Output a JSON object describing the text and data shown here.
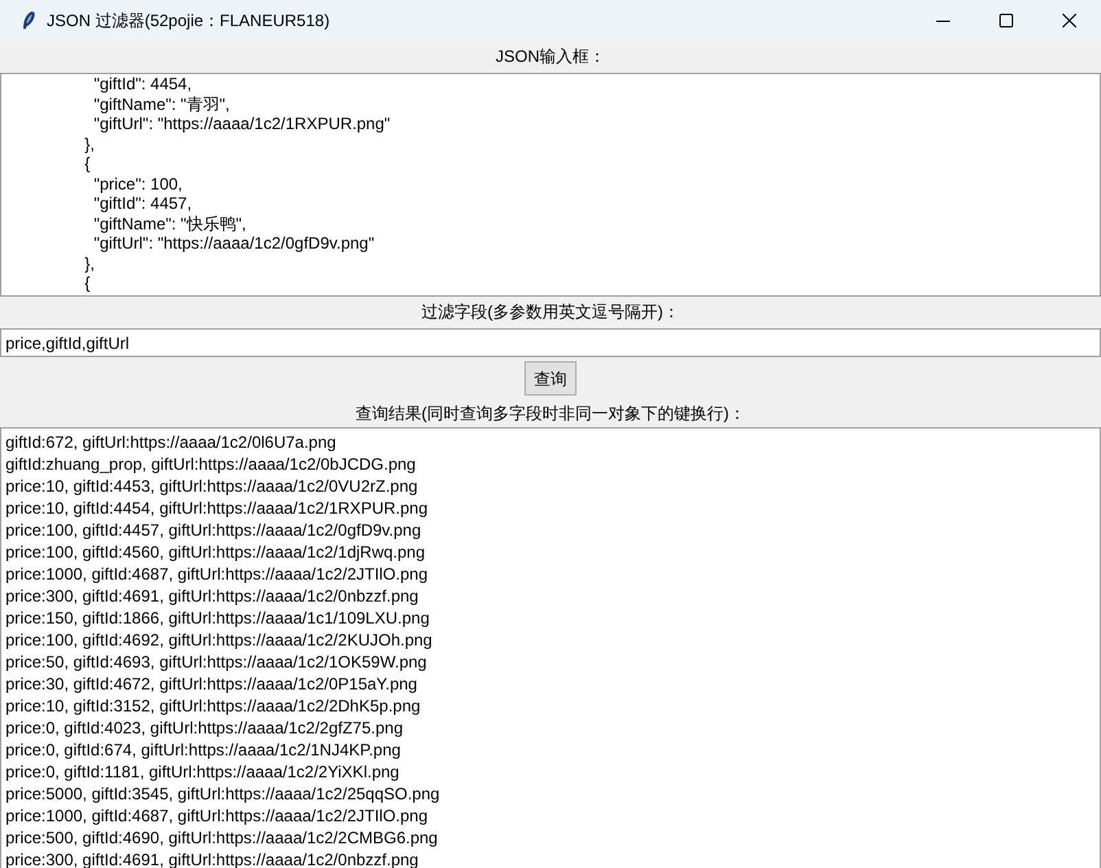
{
  "window": {
    "title": "JSON 过滤器(52pojie：FLANEUR518)"
  },
  "json_input": {
    "label": "JSON输入框：",
    "lines": [
      "    \"giftId\": 4454,",
      "    \"giftName\": \"青羽\",",
      "    \"giftUrl\": \"https://aaaa/1c2/1RXPUR.png\"",
      "  },",
      "  {",
      "    \"price\": 100,",
      "    \"giftId\": 4457,",
      "    \"giftName\": \"快乐鸭\",",
      "    \"giftUrl\": \"https://aaaa/1c2/0gfD9v.png\"",
      "  },",
      "  {"
    ]
  },
  "filter": {
    "label": "过滤字段(多参数用英文逗号隔开)：",
    "value": "price,giftId,giftUrl"
  },
  "query_button": "查询",
  "results": {
    "label": "查询结果(同时查询多字段时非同一对象下的键换行)：",
    "lines": [
      "giftId:672, giftUrl:https://aaaa/1c2/0l6U7a.png",
      "giftId:zhuang_prop, giftUrl:https://aaaa/1c2/0bJCDG.png",
      "price:10, giftId:4453, giftUrl:https://aaaa/1c2/0VU2rZ.png",
      "price:10, giftId:4454, giftUrl:https://aaaa/1c2/1RXPUR.png",
      "price:100, giftId:4457, giftUrl:https://aaaa/1c2/0gfD9v.png",
      "price:100, giftId:4560, giftUrl:https://aaaa/1c2/1djRwq.png",
      "price:1000, giftId:4687, giftUrl:https://aaaa/1c2/2JTIlO.png",
      "price:300, giftId:4691, giftUrl:https://aaaa/1c2/0nbzzf.png",
      "price:150, giftId:1866, giftUrl:https://aaaa/1c1/109LXU.png",
      "price:100, giftId:4692, giftUrl:https://aaaa/1c2/2KUJOh.png",
      "price:50, giftId:4693, giftUrl:https://aaaa/1c2/1OK59W.png",
      "price:30, giftId:4672, giftUrl:https://aaaa/1c2/0P15aY.png",
      "price:10, giftId:3152, giftUrl:https://aaaa/1c2/2DhK5p.png",
      "price:0, giftId:4023, giftUrl:https://aaaa/1c2/2gfZ75.png",
      "price:0, giftId:674, giftUrl:https://aaaa/1c2/1NJ4KP.png",
      "price:0, giftId:1181, giftUrl:https://aaaa/1c2/2YiXKl.png",
      "price:5000, giftId:3545, giftUrl:https://aaaa/1c2/25qqSO.png",
      "price:1000, giftId:4687, giftUrl:https://aaaa/1c2/2JTIlO.png",
      "price:500, giftId:4690, giftUrl:https://aaaa/1c2/2CMBG6.png",
      "price:300, giftId:4691, giftUrl:https://aaaa/1c2/0nbzzf.png"
    ]
  }
}
